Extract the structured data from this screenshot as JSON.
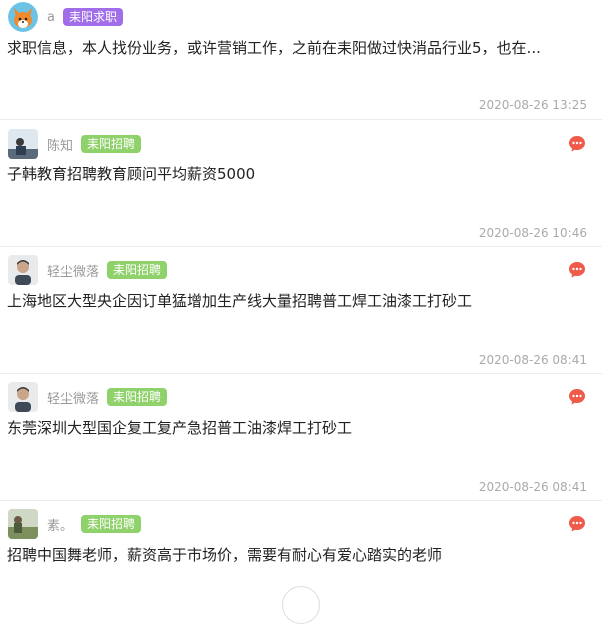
{
  "posts": [
    {
      "author": "a",
      "badge": "耒阳求职",
      "badge_color": "#a06ee8",
      "text": "求职信息，本人找份业务，或许营销工作，之前在耒阳做过快消品行业5，也在...",
      "time": "2020-08-26 13:25",
      "avatar_icon": "fox-avatar-icon",
      "has_message_icon": false
    },
    {
      "author": "陈知",
      "badge": "耒阳招聘",
      "badge_color": "#8fd16a",
      "text": "子韩教育招聘教育顾问平均薪资5000",
      "time": "2020-08-26 10:46",
      "avatar_icon": "person-avatar-icon",
      "has_message_icon": true
    },
    {
      "author": "轻尘微落",
      "badge": "耒阳招聘",
      "badge_color": "#8fd16a",
      "text": "上海地区大型央企因订单猛增加生产线大量招聘普工焊工油漆工打砂工",
      "time": "2020-08-26 08:41",
      "avatar_icon": "person-avatar-icon",
      "has_message_icon": true
    },
    {
      "author": "轻尘微落",
      "badge": "耒阳招聘",
      "badge_color": "#8fd16a",
      "text": "东莞深圳大型国企复工复产急招普工油漆焊工打砂工",
      "time": "2020-08-26 08:41",
      "avatar_icon": "person-avatar-icon",
      "has_message_icon": true
    },
    {
      "author": "素。",
      "badge": "耒阳招聘",
      "badge_color": "#8fd16a",
      "text": "招聘中国舞老师，薪资高于市场价，需要有耐心有爱心踏实的老师",
      "time": "",
      "avatar_icon": "landscape-avatar-icon",
      "has_message_icon": true
    }
  ],
  "colors": {
    "message_icon": "#f05a4a"
  }
}
